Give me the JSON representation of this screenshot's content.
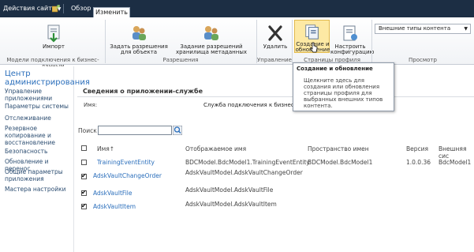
{
  "topbar": {
    "site_actions": "Действия сайта",
    "tabs": [
      "Обзор",
      "Изменить"
    ]
  },
  "ribbon": {
    "buttons": {
      "import": "Импорт",
      "set_object_permissions": "Задать разрешения для объекта",
      "set_metadata_store_permissions": "Задание разрешений хранилища метаданных",
      "delete": "Удалить",
      "create_upgrade": "Создание и обновление",
      "configure": "Настроить конфигурацию"
    },
    "groups": [
      "Модели подключения к бизнес-данным",
      "Разрешения",
      "Управление",
      "Страницы профиля",
      "Просмотр"
    ],
    "view_dropdown": "Внешние типы контента"
  },
  "tooltip": {
    "title": "Создание и обновление",
    "body": "Щелкните здесь для создания или обновления страницы профиля для выбранных внешних типов контента."
  },
  "leftnav": {
    "header": "Центр администрирования",
    "items": [
      "Управление приложениями",
      "Параметры системы",
      "Отслеживание",
      "Резервное копирование и восстановление",
      "Безопасность",
      "Обновление и перенос",
      "Общие параметры приложения",
      "Мастера настройки"
    ]
  },
  "main": {
    "name_label": "Имя:",
    "name_value": "Служба подключения к бизнес-данны",
    "section_title": "Сведения о приложении-службе",
    "search_label": "Поиск",
    "search_value": "",
    "columns": [
      "Имя↑",
      "Отображаемое имя",
      "Пространство имен",
      "Версия",
      "Внешняя сис"
    ],
    "rows": [
      {
        "name": "TrainingEventEntity",
        "display": "BDCModel.BdcModel1.TrainingEventEntity",
        "namespace": "BDCModel.BdcModel1",
        "version": "1.0.0.36",
        "external": "BdcModel1",
        "checked": false
      },
      {
        "name": "AdskVaultChangeOrder",
        "display": "AdskVaultModel.AdskVaultChangeOrder",
        "namespace": "",
        "version": "",
        "external": "",
        "checked": true
      },
      {
        "name": "AdskVaultFile",
        "display": "AdskVaultModel.AdskVaultFile",
        "namespace": "",
        "version": "",
        "external": "",
        "checked": true
      },
      {
        "name": "AdskVaultItem",
        "display": "AdskVaultModel.AdskVaultItem",
        "namespace": "",
        "version": "",
        "external": "",
        "checked": true
      }
    ]
  },
  "colors": {
    "topbar": "#1c2e44",
    "link": "#2a6ebb",
    "highlight": "#fde9a4"
  }
}
